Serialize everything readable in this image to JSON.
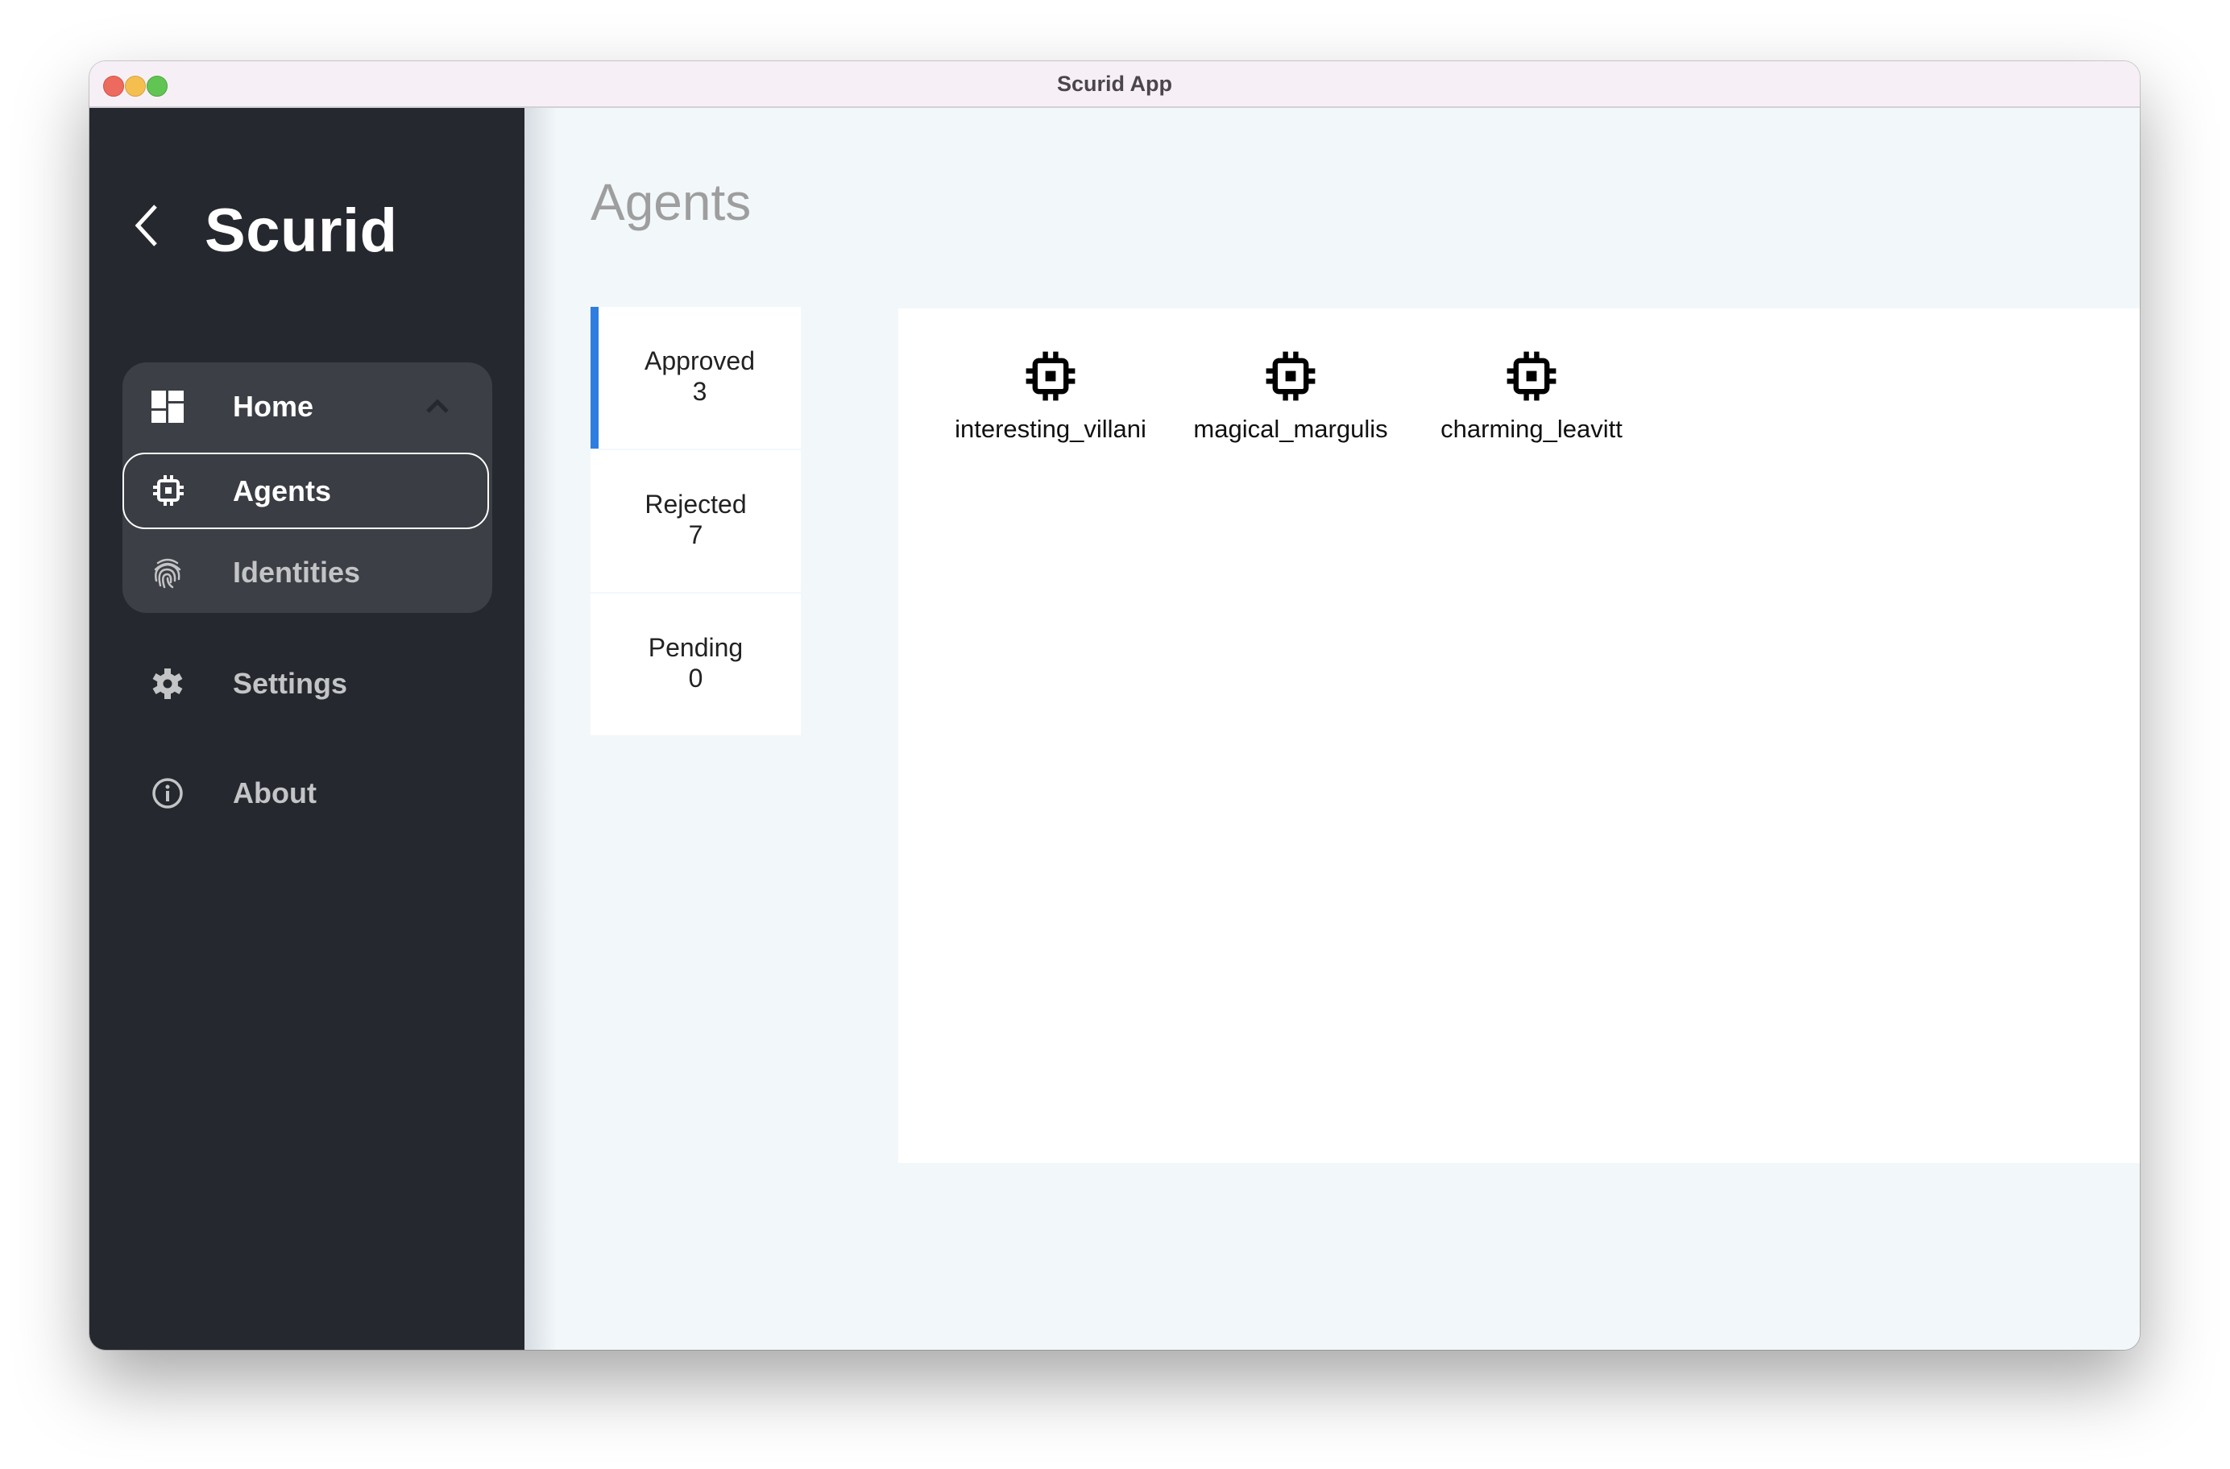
{
  "window": {
    "title": "Scurid App"
  },
  "sidebar": {
    "brand": "Scurid",
    "back_icon": "chevron-left-icon",
    "nav_group": {
      "home": {
        "label": "Home",
        "icon": "dashboard-icon",
        "expanded": true
      },
      "items": [
        {
          "label": "Agents",
          "icon": "chip-icon",
          "selected": true
        },
        {
          "label": "Identities",
          "icon": "fingerprint-icon",
          "selected": false
        }
      ]
    },
    "items": [
      {
        "label": "Settings",
        "icon": "gear-icon"
      },
      {
        "label": "About",
        "icon": "info-icon"
      }
    ]
  },
  "main": {
    "title": "Agents",
    "tabs": [
      {
        "label": "Approved",
        "count": "3",
        "active": true
      },
      {
        "label": "Rejected",
        "count": "7",
        "active": false
      },
      {
        "label": "Pending",
        "count": "0",
        "active": false
      }
    ],
    "agents": [
      {
        "name": "interesting_villani",
        "icon": "chip-icon"
      },
      {
        "name": "magical_margulis",
        "icon": "chip-icon"
      },
      {
        "name": "charming_leavitt",
        "icon": "chip-icon"
      }
    ]
  },
  "colors": {
    "sidebar_bg": "#25282e",
    "nav_group_bg": "#3c3f45",
    "accent": "#2f7de1",
    "main_bg": "#f2f7fa"
  }
}
